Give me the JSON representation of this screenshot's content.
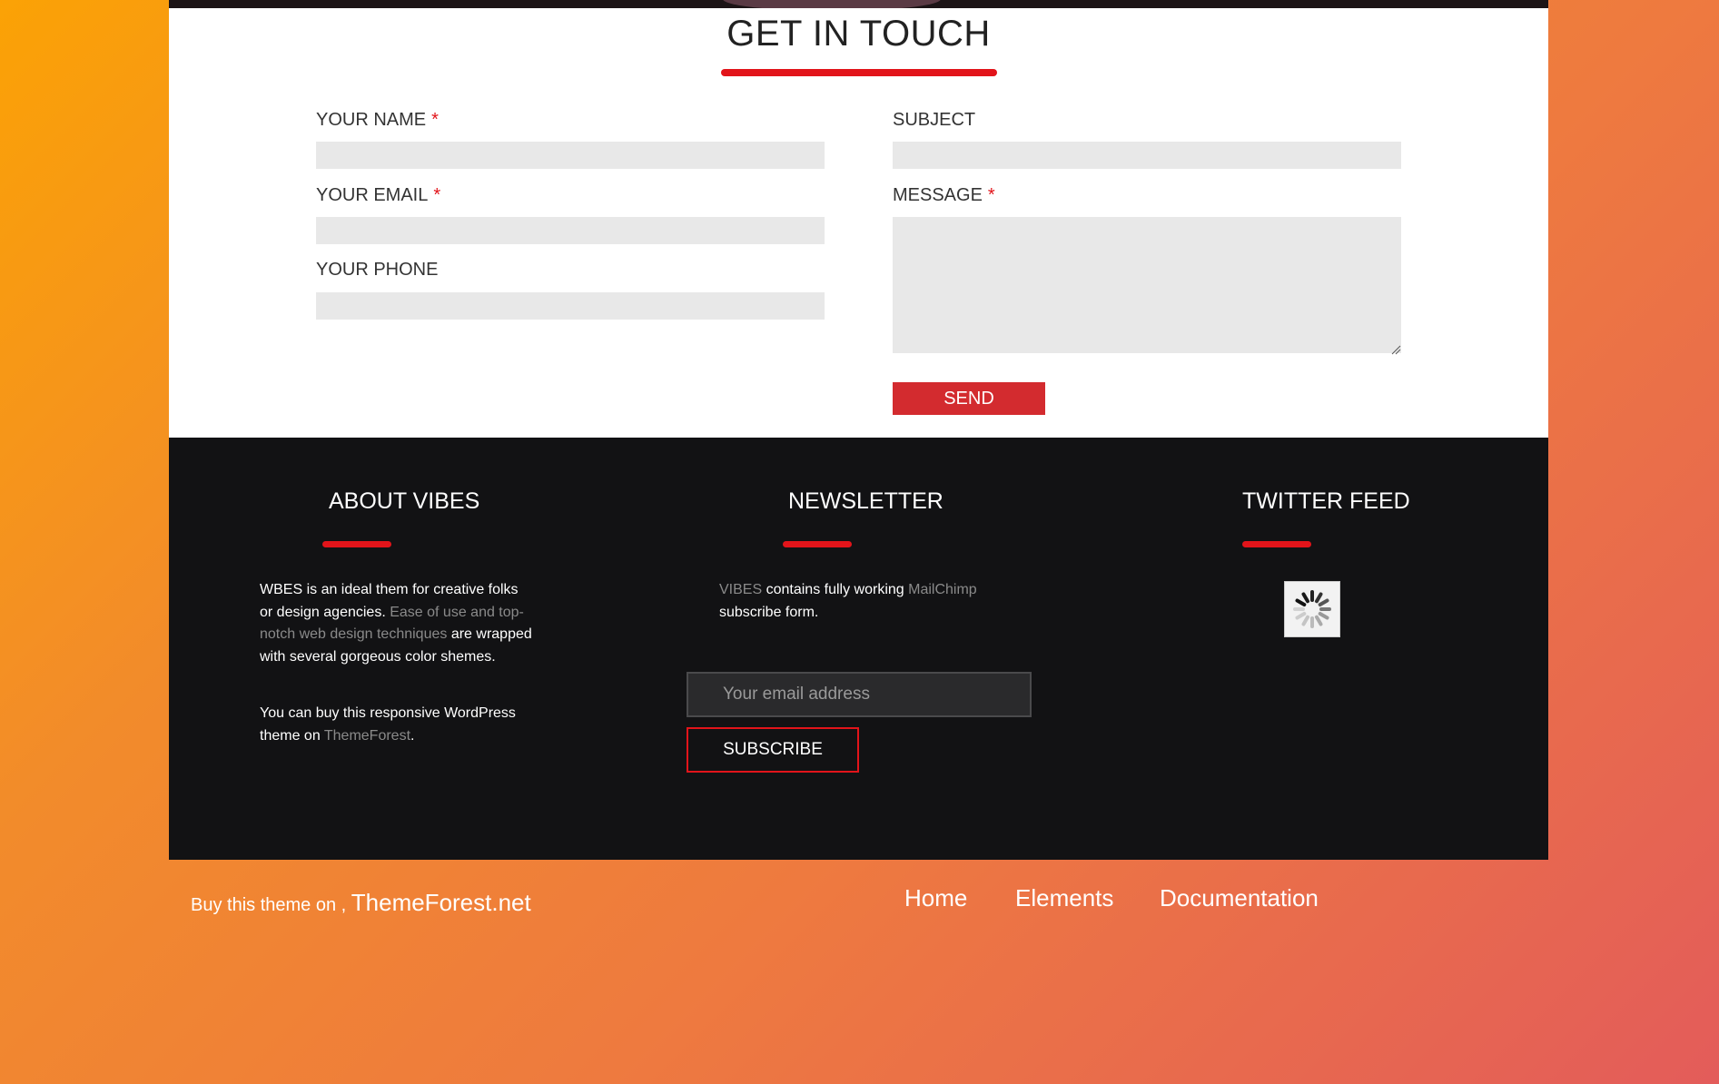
{
  "contact": {
    "title": "GET IN TOUCH",
    "name_label": "YOUR NAME",
    "email_label": "YOUR EMAIL",
    "phone_label": "YOUR PHONE",
    "subject_label": "SUBJECT",
    "message_label": "MESSAGE",
    "required_mark": "*",
    "send_label": "SEND"
  },
  "about": {
    "title": "ABOUT VIBES",
    "p1_a": "WBES is an ideal them for creative folks or design agencies.",
    "p1_b": "Ease of use and top-notch web design techniques",
    "p1_c": "are wrapped with several gorgeous color shemes.",
    "p2_a": "You can buy this responsive WordPress theme on",
    "p2_link": "ThemeForest",
    "p2_end": "."
  },
  "newsletter": {
    "title": "NEWSLETTER",
    "text_a": "VIBES",
    "text_b": "contains fully working",
    "text_c": "MailChimp",
    "text_d": "subscribe form.",
    "email_placeholder": "Your email address",
    "subscribe_label": "SUBSCRIBE"
  },
  "twitter": {
    "title": "TWITTER FEED",
    "loading_icon": "spinner-icon"
  },
  "bottom": {
    "buy_text": "Buy this theme on ,",
    "buy_link": "ThemeForest.net",
    "nav": [
      "Home",
      "Elements",
      "Documentation"
    ]
  },
  "colors": {
    "accent": "#e2141a",
    "send_button": "#d32b2f",
    "footer_bg": "#121214",
    "input_bg": "#e8e8e8"
  }
}
